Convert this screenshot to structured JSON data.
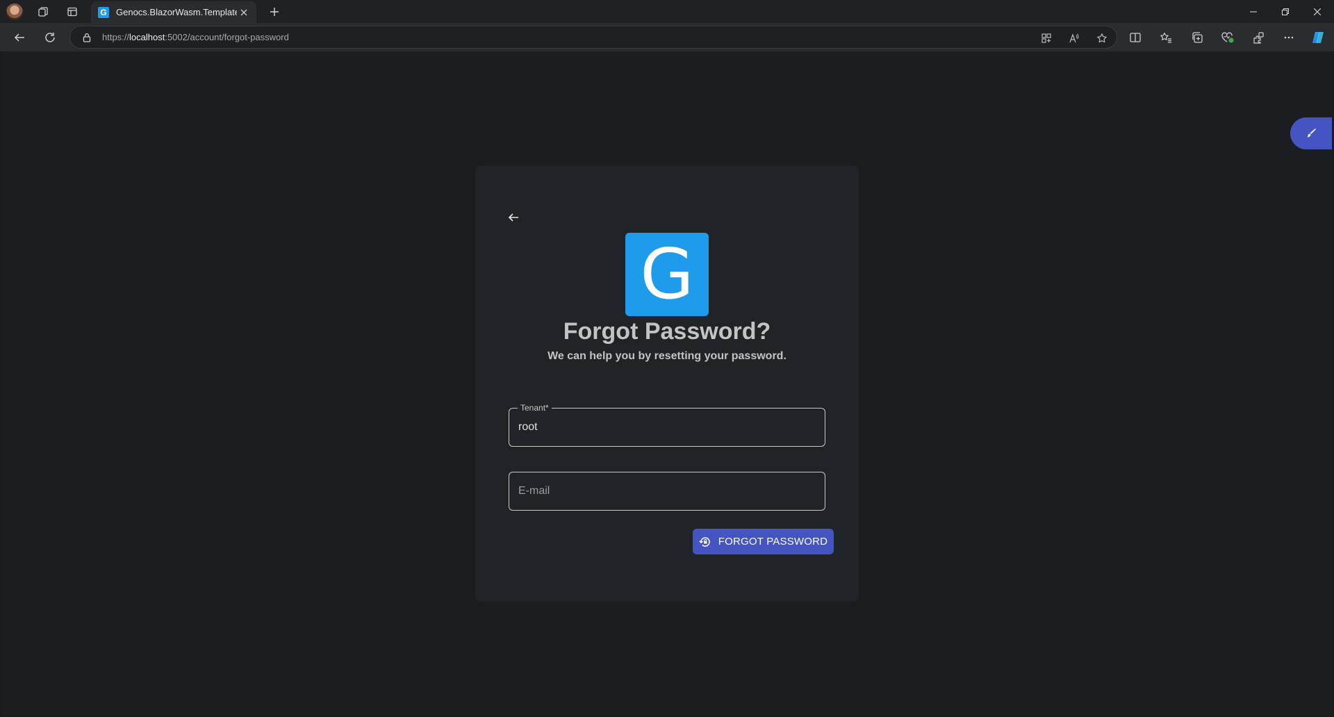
{
  "browser": {
    "tab": {
      "favicon_letter": "G",
      "title": "Genocs.BlazorWasm.Template"
    },
    "url": {
      "scheme": "https://",
      "host": "localhost",
      "rest": ":5002/account/forgot-password"
    },
    "icons": {
      "tabbar": [
        "profile-avatar",
        "workspaces-icon",
        "tab-actions-icon",
        "close-icon",
        "plus-icon",
        "minimize-icon",
        "restore-icon",
        "window-close-icon"
      ],
      "toolbar": [
        "back-arrow-icon",
        "refresh-icon",
        "lock-icon",
        "app-available-icon",
        "read-aloud-icon",
        "star-icon",
        "split-screen-icon",
        "favorites-icon",
        "collections-icon",
        "browser-essentials-icon",
        "extensions-icon",
        "more-icon",
        "copilot-icon"
      ]
    }
  },
  "page": {
    "logo_letter": "G",
    "title": "Forgot Password?",
    "subtitle": "We can help you by resetting your password.",
    "tenant_field": {
      "label": "Tenant*",
      "value": "root"
    },
    "email_field": {
      "placeholder": "E-mail",
      "value": ""
    },
    "submit_button": {
      "label": "FORGOT PASSWORD"
    }
  },
  "colors": {
    "accent": "#4554c3",
    "logo_bg": "#1e9bea",
    "page_bg": "#1b1e21",
    "card_bg": "#202428"
  }
}
